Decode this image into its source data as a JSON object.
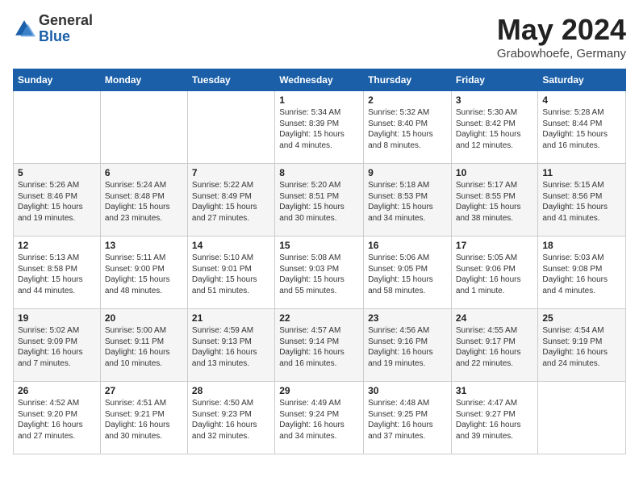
{
  "header": {
    "logo_general": "General",
    "logo_blue": "Blue",
    "month_title": "May 2024",
    "location": "Grabowhoefe, Germany"
  },
  "days_of_week": [
    "Sunday",
    "Monday",
    "Tuesday",
    "Wednesday",
    "Thursday",
    "Friday",
    "Saturday"
  ],
  "weeks": [
    [
      {
        "day": "",
        "info": ""
      },
      {
        "day": "",
        "info": ""
      },
      {
        "day": "",
        "info": ""
      },
      {
        "day": "1",
        "info": "Sunrise: 5:34 AM\nSunset: 8:39 PM\nDaylight: 15 hours\nand 4 minutes."
      },
      {
        "day": "2",
        "info": "Sunrise: 5:32 AM\nSunset: 8:40 PM\nDaylight: 15 hours\nand 8 minutes."
      },
      {
        "day": "3",
        "info": "Sunrise: 5:30 AM\nSunset: 8:42 PM\nDaylight: 15 hours\nand 12 minutes."
      },
      {
        "day": "4",
        "info": "Sunrise: 5:28 AM\nSunset: 8:44 PM\nDaylight: 15 hours\nand 16 minutes."
      }
    ],
    [
      {
        "day": "5",
        "info": "Sunrise: 5:26 AM\nSunset: 8:46 PM\nDaylight: 15 hours\nand 19 minutes."
      },
      {
        "day": "6",
        "info": "Sunrise: 5:24 AM\nSunset: 8:48 PM\nDaylight: 15 hours\nand 23 minutes."
      },
      {
        "day": "7",
        "info": "Sunrise: 5:22 AM\nSunset: 8:49 PM\nDaylight: 15 hours\nand 27 minutes."
      },
      {
        "day": "8",
        "info": "Sunrise: 5:20 AM\nSunset: 8:51 PM\nDaylight: 15 hours\nand 30 minutes."
      },
      {
        "day": "9",
        "info": "Sunrise: 5:18 AM\nSunset: 8:53 PM\nDaylight: 15 hours\nand 34 minutes."
      },
      {
        "day": "10",
        "info": "Sunrise: 5:17 AM\nSunset: 8:55 PM\nDaylight: 15 hours\nand 38 minutes."
      },
      {
        "day": "11",
        "info": "Sunrise: 5:15 AM\nSunset: 8:56 PM\nDaylight: 15 hours\nand 41 minutes."
      }
    ],
    [
      {
        "day": "12",
        "info": "Sunrise: 5:13 AM\nSunset: 8:58 PM\nDaylight: 15 hours\nand 44 minutes."
      },
      {
        "day": "13",
        "info": "Sunrise: 5:11 AM\nSunset: 9:00 PM\nDaylight: 15 hours\nand 48 minutes."
      },
      {
        "day": "14",
        "info": "Sunrise: 5:10 AM\nSunset: 9:01 PM\nDaylight: 15 hours\nand 51 minutes."
      },
      {
        "day": "15",
        "info": "Sunrise: 5:08 AM\nSunset: 9:03 PM\nDaylight: 15 hours\nand 55 minutes."
      },
      {
        "day": "16",
        "info": "Sunrise: 5:06 AM\nSunset: 9:05 PM\nDaylight: 15 hours\nand 58 minutes."
      },
      {
        "day": "17",
        "info": "Sunrise: 5:05 AM\nSunset: 9:06 PM\nDaylight: 16 hours\nand 1 minute."
      },
      {
        "day": "18",
        "info": "Sunrise: 5:03 AM\nSunset: 9:08 PM\nDaylight: 16 hours\nand 4 minutes."
      }
    ],
    [
      {
        "day": "19",
        "info": "Sunrise: 5:02 AM\nSunset: 9:09 PM\nDaylight: 16 hours\nand 7 minutes."
      },
      {
        "day": "20",
        "info": "Sunrise: 5:00 AM\nSunset: 9:11 PM\nDaylight: 16 hours\nand 10 minutes."
      },
      {
        "day": "21",
        "info": "Sunrise: 4:59 AM\nSunset: 9:13 PM\nDaylight: 16 hours\nand 13 minutes."
      },
      {
        "day": "22",
        "info": "Sunrise: 4:57 AM\nSunset: 9:14 PM\nDaylight: 16 hours\nand 16 minutes."
      },
      {
        "day": "23",
        "info": "Sunrise: 4:56 AM\nSunset: 9:16 PM\nDaylight: 16 hours\nand 19 minutes."
      },
      {
        "day": "24",
        "info": "Sunrise: 4:55 AM\nSunset: 9:17 PM\nDaylight: 16 hours\nand 22 minutes."
      },
      {
        "day": "25",
        "info": "Sunrise: 4:54 AM\nSunset: 9:19 PM\nDaylight: 16 hours\nand 24 minutes."
      }
    ],
    [
      {
        "day": "26",
        "info": "Sunrise: 4:52 AM\nSunset: 9:20 PM\nDaylight: 16 hours\nand 27 minutes."
      },
      {
        "day": "27",
        "info": "Sunrise: 4:51 AM\nSunset: 9:21 PM\nDaylight: 16 hours\nand 30 minutes."
      },
      {
        "day": "28",
        "info": "Sunrise: 4:50 AM\nSunset: 9:23 PM\nDaylight: 16 hours\nand 32 minutes."
      },
      {
        "day": "29",
        "info": "Sunrise: 4:49 AM\nSunset: 9:24 PM\nDaylight: 16 hours\nand 34 minutes."
      },
      {
        "day": "30",
        "info": "Sunrise: 4:48 AM\nSunset: 9:25 PM\nDaylight: 16 hours\nand 37 minutes."
      },
      {
        "day": "31",
        "info": "Sunrise: 4:47 AM\nSunset: 9:27 PM\nDaylight: 16 hours\nand 39 minutes."
      },
      {
        "day": "",
        "info": ""
      }
    ]
  ]
}
